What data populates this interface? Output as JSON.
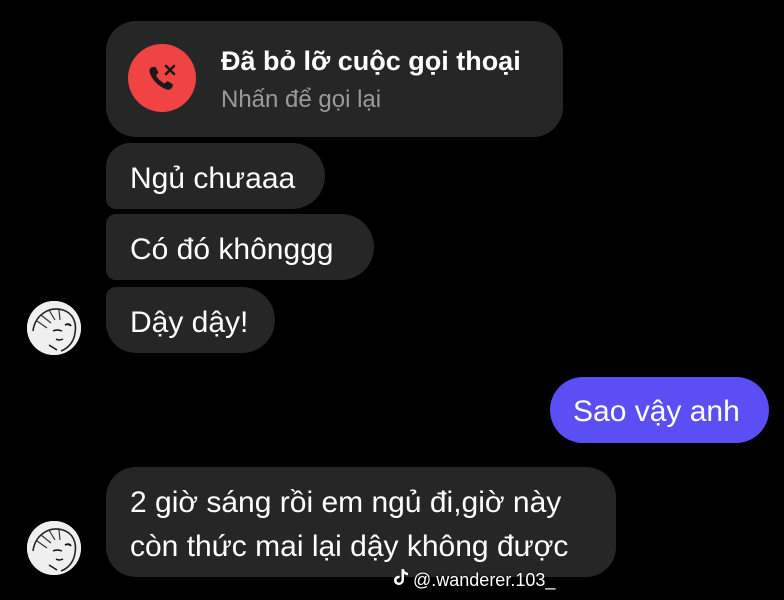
{
  "missed_call": {
    "title": "Đã bỏ lỡ cuộc gọi thoại",
    "subtitle": "Nhấn để gọi lại",
    "icon": "missed-call-icon",
    "icon_color": "#f04343"
  },
  "messages": [
    {
      "text": "Ngủ chưaaa",
      "direction": "incoming"
    },
    {
      "text": "Có đó khônggg",
      "direction": "incoming"
    },
    {
      "text": "Dậy dậy!",
      "direction": "incoming"
    },
    {
      "text": "Sao vậy anh",
      "direction": "outgoing"
    },
    {
      "lines": [
        "2 giờ sáng rồi em ngủ đi,giờ này",
        "còn thức mai lại dậy không được"
      ],
      "direction": "incoming"
    }
  ],
  "watermark": {
    "icon": "tiktok-icon",
    "text": "@.wanderer.103_"
  },
  "colors": {
    "background": "#000000",
    "incoming_bubble": "#262626",
    "outgoing_bubble": "#5b4ef5"
  }
}
